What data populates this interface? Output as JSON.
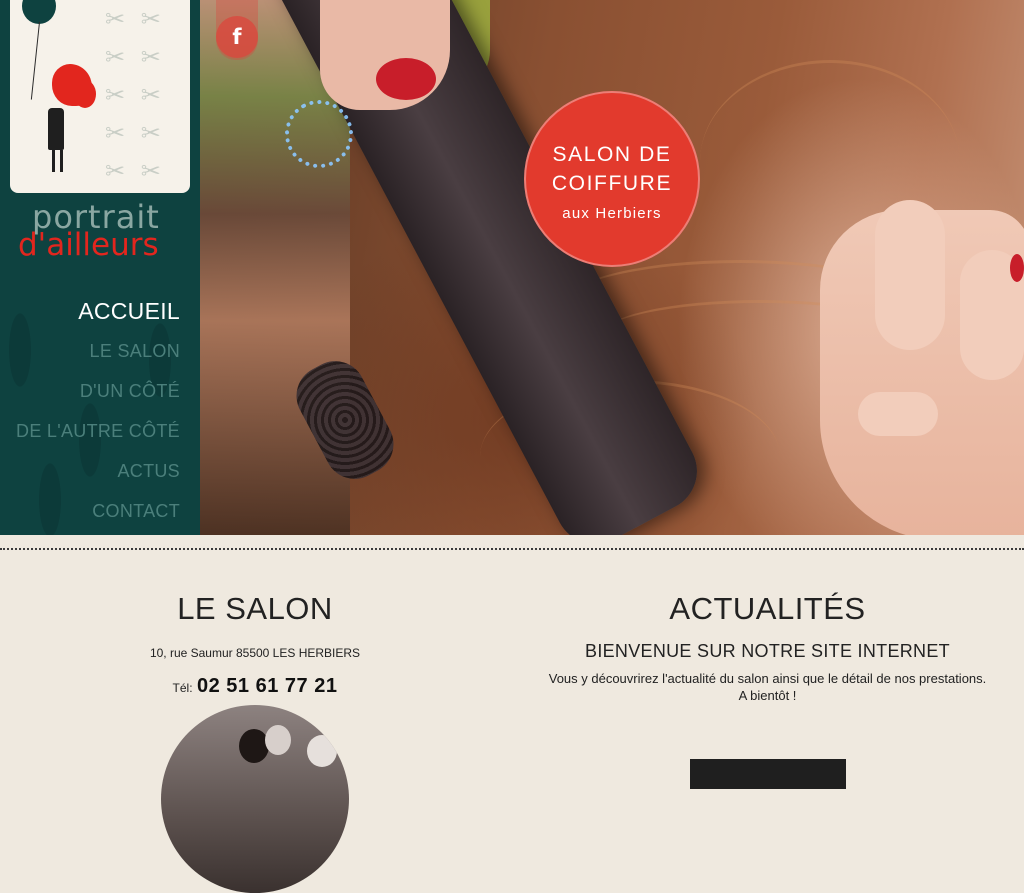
{
  "brand": {
    "logo_line1": "portrait",
    "logo_line2": "d'ailleurs",
    "accent_color": "#e2261e",
    "sidebar_color": "#0e4240"
  },
  "nav": {
    "items": [
      {
        "label": "ACCUEIL",
        "active": true
      },
      {
        "label": "LE SALON",
        "active": false
      },
      {
        "label": "D'UN CÔTÉ",
        "active": false
      },
      {
        "label": "DE L'AUTRE CÔTÉ",
        "active": false
      },
      {
        "label": "ACTUS",
        "active": false
      },
      {
        "label": "CONTACT",
        "active": false
      }
    ]
  },
  "social": {
    "facebook_glyph": "f",
    "facebook_icon": "facebook-icon"
  },
  "hero": {
    "badge_line1": "SALON DE",
    "badge_line2": "COIFFURE",
    "badge_line3": "aux Herbiers"
  },
  "salon": {
    "title": "LE SALON",
    "address": "10, rue Saumur 85500 LES HERBIERS",
    "phone_label": "Tél:",
    "phone": "02 51 61 77 21"
  },
  "news": {
    "title": "ACTUALITÉS",
    "subtitle": "BIENVENUE SUR NOTRE SITE INTERNET",
    "text_line1": "Vous y découvrirez l'actualité du salon ainsi que le détail de nos prestations.",
    "text_line2": "A bientôt !"
  }
}
